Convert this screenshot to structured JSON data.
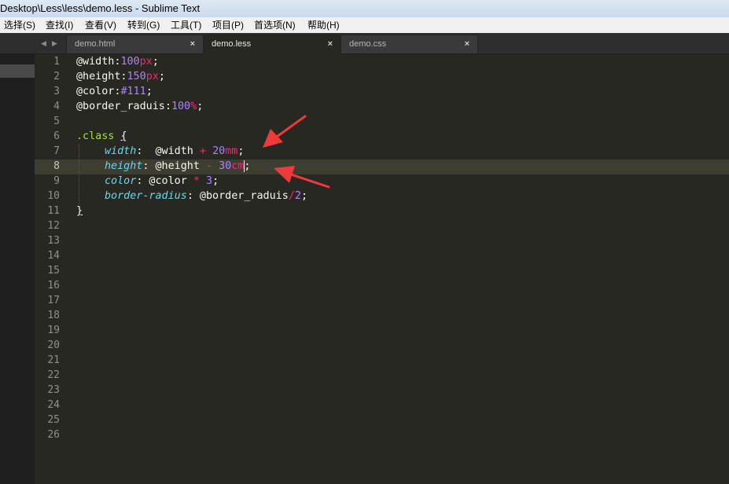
{
  "window": {
    "title": "Desktop\\Less\\less\\demo.less - Sublime Text"
  },
  "menu": [
    {
      "label": "选择(S)"
    },
    {
      "label": "查找(I)"
    },
    {
      "label": "查看(V)"
    },
    {
      "label": "转到(G)"
    },
    {
      "label": "工具(T)"
    },
    {
      "label": "项目(P)"
    },
    {
      "label": "首选项(N)"
    },
    {
      "label": "帮助(H)"
    }
  ],
  "tabs": [
    {
      "label": "demo.html",
      "close": "×",
      "active": false
    },
    {
      "label": "demo.less",
      "close": "×",
      "active": true
    },
    {
      "label": "demo.css",
      "close": "×",
      "active": false
    }
  ],
  "nav": {
    "prev": "◀",
    "next": "▶"
  },
  "gutter": {
    "line_numbers": [
      "1",
      "2",
      "3",
      "4",
      "5",
      "6",
      "7",
      "8",
      "9",
      "10",
      "11",
      "12",
      "13",
      "14",
      "15",
      "16",
      "17",
      "18",
      "19",
      "20",
      "21",
      "22",
      "23",
      "24",
      "25",
      "26"
    ],
    "current_line": "8"
  },
  "code": {
    "l1": {
      "var": "@width:",
      "num": "100",
      "unit": "px",
      "end": ";"
    },
    "l2": {
      "var": "@height:",
      "num": "150",
      "unit": "px",
      "end": ";"
    },
    "l3": {
      "var": "@color:",
      "num": "#111",
      "end": ";"
    },
    "l4": {
      "var": "@border_raduis:",
      "num": "100",
      "unit": "%",
      "end": ";"
    },
    "l6": {
      "selector": ".class",
      "brace": "{"
    },
    "l7": {
      "prop": "width",
      "colon": ":  @width ",
      "op": "+",
      "num": "20",
      "unit": "mm",
      "end": ";"
    },
    "l8": {
      "prop": "height",
      "colon": ": @height ",
      "op": "-",
      "num": "30",
      "unit": "cm",
      "end": ";"
    },
    "l9": {
      "prop": "color",
      "colon": ": @color ",
      "op": "*",
      "num": "3",
      "end": ";"
    },
    "l10": {
      "prop": "border-radius",
      "colon": ": @border_raduis",
      "op": "/",
      "num": "2",
      "end": ";"
    },
    "l11": {
      "brace": "}"
    }
  },
  "annotation_color": "#f03a3a"
}
